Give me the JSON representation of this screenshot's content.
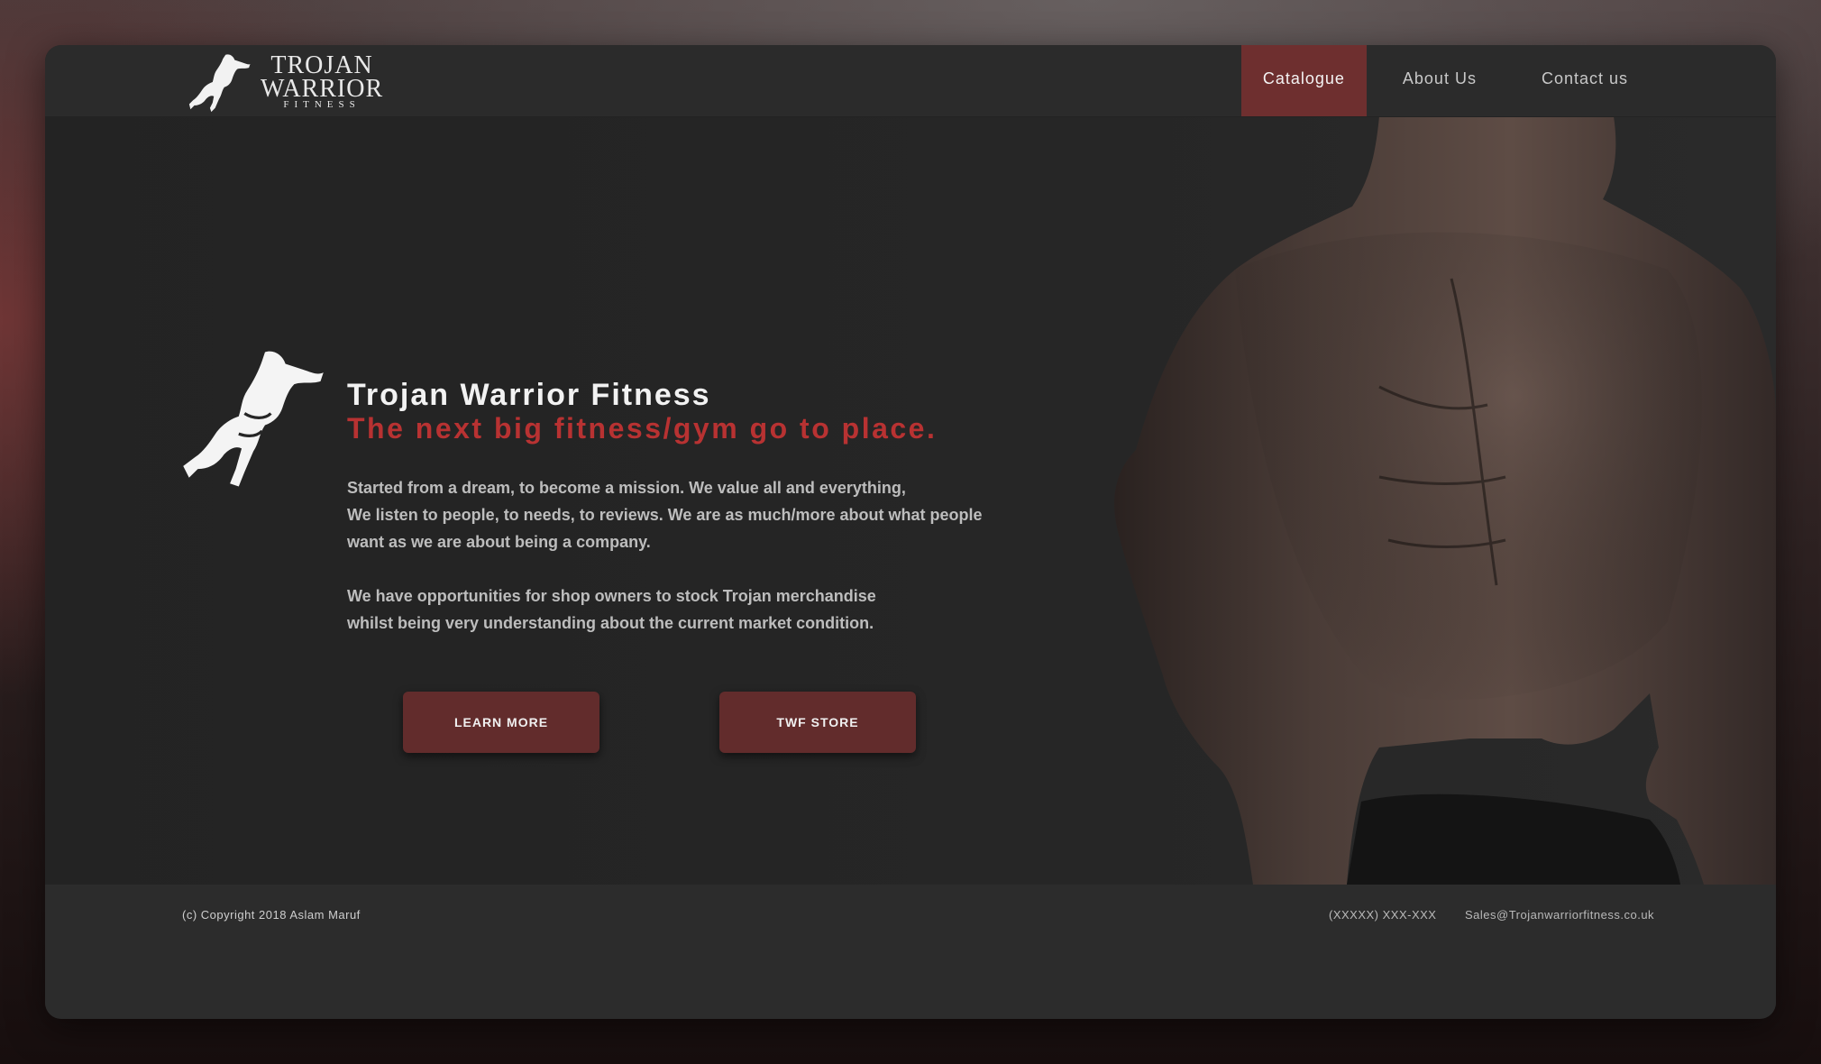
{
  "brand": {
    "line1": "TROJAN",
    "line2": "WARRIOR",
    "line3": "FITNESS"
  },
  "nav": {
    "items": [
      {
        "label": "Catalogue",
        "active": true
      },
      {
        "label": "About Us",
        "active": false
      },
      {
        "label": "Contact us",
        "active": false
      }
    ]
  },
  "hero": {
    "title": "Trojan Warrior Fitness",
    "tagline": "The next big fitness/gym go to place.",
    "paragraph1": [
      "Started from a dream, to become a mission. We value all and everything,",
      "We listen to people, to needs, to reviews. We are as much/more about what people",
      "want as we are about being a company."
    ],
    "paragraph2": [
      "We have opportunities for shop owners to stock Trojan merchandise",
      "whilst being very understanding about the current market condition."
    ],
    "buttons": {
      "learn_more": "LEARN MORE",
      "store": "TWF STORE"
    }
  },
  "footer": {
    "copyright": "(c) Copyright 2018 Aslam Maruf",
    "phone": "(XXXXX) XXX-XXX",
    "email": "Sales@Trojanwarriorfitness.co.uk"
  },
  "colors": {
    "accent": "#6e2f2f",
    "tagline_red": "#b83232",
    "card_bg": "#262626"
  }
}
